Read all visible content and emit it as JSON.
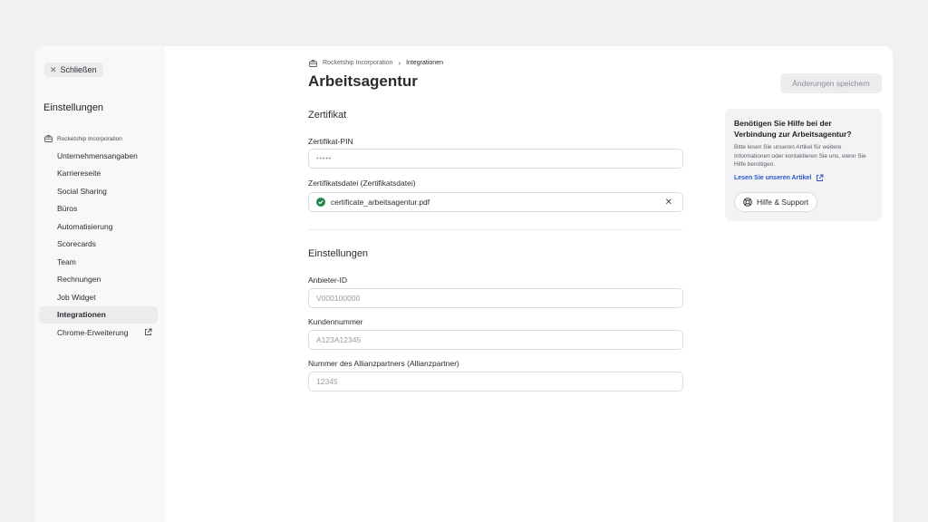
{
  "sidebar": {
    "close_label": "Schließen",
    "title": "Einstellungen",
    "company": "Rocketship Incorporation",
    "items": [
      {
        "label": "Unternehmensangaben"
      },
      {
        "label": "Karriereseite"
      },
      {
        "label": "Social Sharing"
      },
      {
        "label": "Büros"
      },
      {
        "label": "Automatisierung"
      },
      {
        "label": "Scorecards"
      },
      {
        "label": "Team"
      },
      {
        "label": "Rechnungen"
      },
      {
        "label": "Job Widget"
      },
      {
        "label": "Integrationen",
        "active": true
      },
      {
        "label": "Chrome-Erweiterung",
        "external": true
      }
    ]
  },
  "breadcrumb": {
    "company": "Rocketship Incorporation",
    "current": "Integrationen"
  },
  "page": {
    "title": "Arbeitsagentur",
    "save_label": "Änderungen speichern"
  },
  "certificate": {
    "section_title": "Zertifikat",
    "pin_label": "Zertifikat-PIN",
    "pin_value": "•••••",
    "file_label": "Zertifikatsdatei (Zertifikatsdatei)",
    "file_name": "certificate_arbeitsagentur.pdf"
  },
  "settings": {
    "section_title": "Einstellungen",
    "provider_label": "Anbieter-ID",
    "provider_placeholder": "V000100000",
    "customer_label": "Kundennummer",
    "customer_placeholder": "A123A12345",
    "partner_label": "Nummer des Allianzpartners (Allianzpartner)",
    "partner_placeholder": "12345"
  },
  "help": {
    "title": "Benötigen Sie Hilfe bei der Verbindung zur Arbeitsagentur?",
    "body": "Bitte lesen Sie unseren Artikel für weitere Informationen oder kontaktieren Sie uns, wenn Sie Hilfe benötigen.",
    "link_label": "Lesen Sie unseren Artikel",
    "button_label": "Hilfe & Support"
  },
  "colors": {
    "accent_link": "#2a56c6",
    "success": "#1f8a4c"
  }
}
